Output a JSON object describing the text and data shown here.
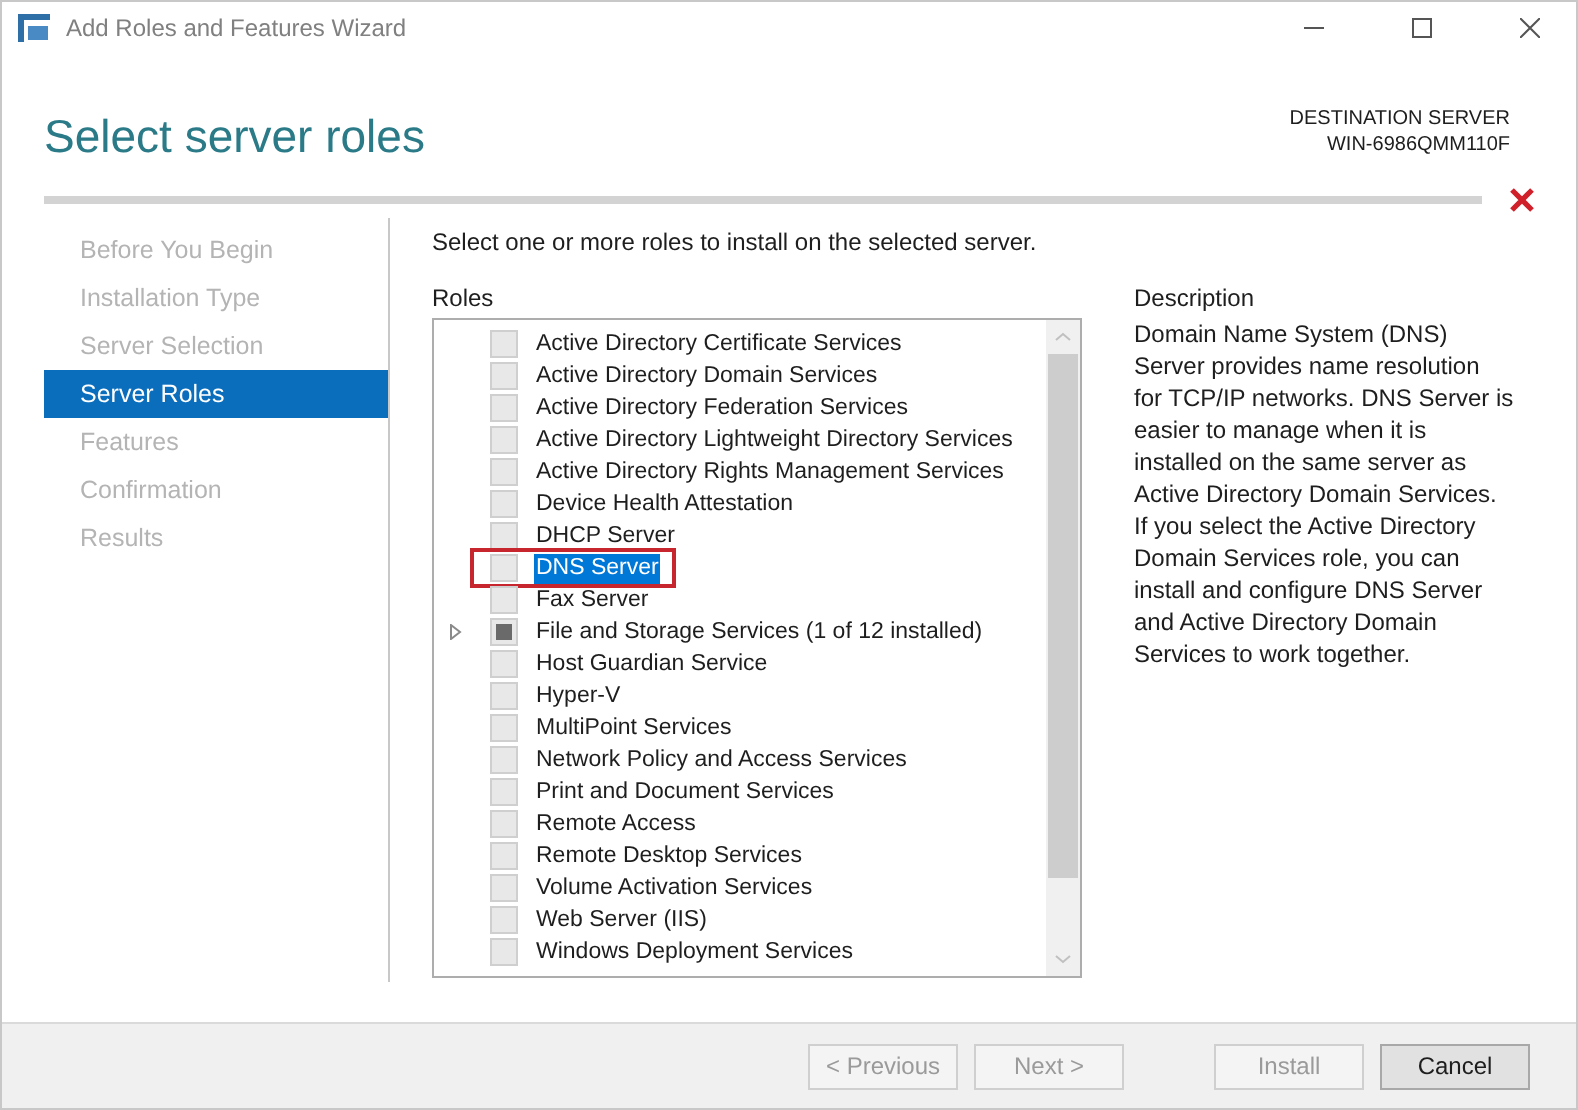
{
  "window": {
    "title": "Add Roles and Features Wizard"
  },
  "header": {
    "title": "Select server roles",
    "destination_label": "DESTINATION SERVER",
    "destination_server": "WIN-6986QMM110F"
  },
  "steps": [
    {
      "label": "Before You Begin",
      "selected": false
    },
    {
      "label": "Installation Type",
      "selected": false
    },
    {
      "label": "Server Selection",
      "selected": false
    },
    {
      "label": "Server Roles",
      "selected": true
    },
    {
      "label": "Features",
      "selected": false
    },
    {
      "label": "Confirmation",
      "selected": false
    },
    {
      "label": "Results",
      "selected": false
    }
  ],
  "instruction": "Select one or more roles to install on the selected server.",
  "roles_heading": "Roles",
  "roles": [
    {
      "label": "Active Directory Certificate Services",
      "partial": false,
      "expandable": false,
      "selected": false,
      "annotated": false
    },
    {
      "label": "Active Directory Domain Services",
      "partial": false,
      "expandable": false,
      "selected": false,
      "annotated": false
    },
    {
      "label": "Active Directory Federation Services",
      "partial": false,
      "expandable": false,
      "selected": false,
      "annotated": false
    },
    {
      "label": "Active Directory Lightweight Directory Services",
      "partial": false,
      "expandable": false,
      "selected": false,
      "annotated": false
    },
    {
      "label": "Active Directory Rights Management Services",
      "partial": false,
      "expandable": false,
      "selected": false,
      "annotated": false
    },
    {
      "label": "Device Health Attestation",
      "partial": false,
      "expandable": false,
      "selected": false,
      "annotated": false
    },
    {
      "label": "DHCP Server",
      "partial": false,
      "expandable": false,
      "selected": false,
      "annotated": false
    },
    {
      "label": "DNS Server",
      "partial": false,
      "expandable": false,
      "selected": true,
      "annotated": true
    },
    {
      "label": "Fax Server",
      "partial": false,
      "expandable": false,
      "selected": false,
      "annotated": false
    },
    {
      "label": "File and Storage Services (1 of 12 installed)",
      "partial": true,
      "expandable": true,
      "selected": false,
      "annotated": false
    },
    {
      "label": "Host Guardian Service",
      "partial": false,
      "expandable": false,
      "selected": false,
      "annotated": false
    },
    {
      "label": "Hyper-V",
      "partial": false,
      "expandable": false,
      "selected": false,
      "annotated": false
    },
    {
      "label": "MultiPoint Services",
      "partial": false,
      "expandable": false,
      "selected": false,
      "annotated": false
    },
    {
      "label": "Network Policy and Access Services",
      "partial": false,
      "expandable": false,
      "selected": false,
      "annotated": false
    },
    {
      "label": "Print and Document Services",
      "partial": false,
      "expandable": false,
      "selected": false,
      "annotated": false
    },
    {
      "label": "Remote Access",
      "partial": false,
      "expandable": false,
      "selected": false,
      "annotated": false
    },
    {
      "label": "Remote Desktop Services",
      "partial": false,
      "expandable": false,
      "selected": false,
      "annotated": false
    },
    {
      "label": "Volume Activation Services",
      "partial": false,
      "expandable": false,
      "selected": false,
      "annotated": false
    },
    {
      "label": "Web Server (IIS)",
      "partial": false,
      "expandable": false,
      "selected": false,
      "annotated": false
    },
    {
      "label": "Windows Deployment Services",
      "partial": false,
      "expandable": false,
      "selected": false,
      "annotated": false
    }
  ],
  "description_heading": "Description",
  "description": "Domain Name System (DNS) Server provides name resolution for TCP/IP networks. DNS Server is easier to manage when it is installed on the same server as Active Directory Domain Services. If you select the Active Directory Domain Services role, you can install and configure DNS Server and Active Directory Domain Services to work together.",
  "buttons": [
    {
      "label": "< Previous",
      "disabled": true
    },
    {
      "label": "Next >",
      "disabled": true
    },
    {
      "label": "Install",
      "disabled": true
    },
    {
      "label": "Cancel",
      "disabled": false
    }
  ]
}
